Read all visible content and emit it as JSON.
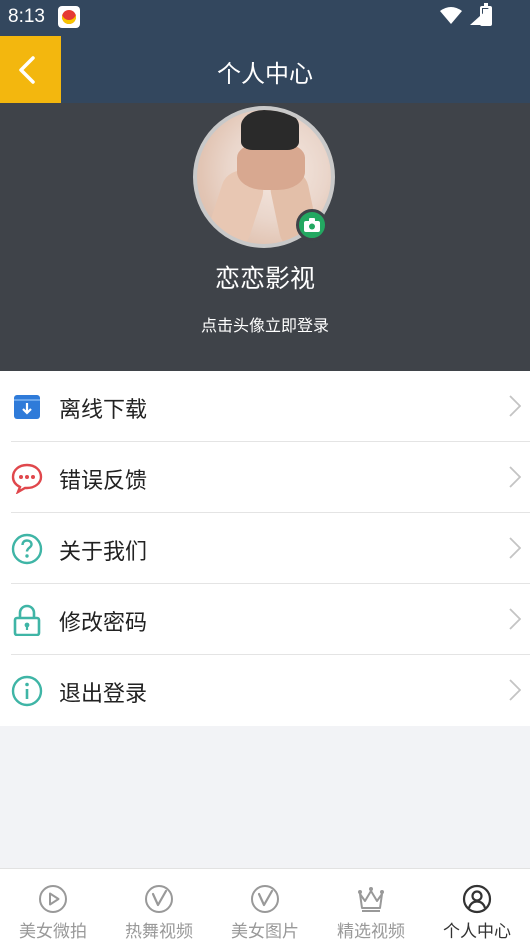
{
  "status_bar": {
    "time": "8:13"
  },
  "header": {
    "title": "个人中心",
    "back_icon": "chevron-left-icon"
  },
  "profile": {
    "name": "恋恋影视",
    "login_hint": "点击头像立即登录"
  },
  "menu": {
    "items": [
      {
        "label": "离线下载",
        "icon": "download-box-icon",
        "color": "#2f7bd9"
      },
      {
        "label": "错误反馈",
        "icon": "chat-bubble-icon",
        "color": "#e0474c"
      },
      {
        "label": "关于我们",
        "icon": "question-circle-icon",
        "color": "#3fb5a6"
      },
      {
        "label": "修改密码",
        "icon": "lock-icon",
        "color": "#3fb5a6"
      },
      {
        "label": "退出登录",
        "icon": "info-circle-icon",
        "color": "#3fb5a6"
      }
    ]
  },
  "tabbar": {
    "tabs": [
      {
        "label": "美女微拍",
        "icon": "play-circle-icon",
        "active": false
      },
      {
        "label": "热舞视频",
        "icon": "v-circle-icon",
        "active": false
      },
      {
        "label": "美女图片",
        "icon": "v-circle-icon",
        "active": false
      },
      {
        "label": "精选视频",
        "icon": "crown-icon",
        "active": false
      },
      {
        "label": "个人中心",
        "icon": "user-circle-icon",
        "active": true
      }
    ]
  },
  "colors": {
    "header_bg": "#33475e",
    "accent": "#f3b70e",
    "profile_bg": "#3f4349",
    "badge": "#23a861"
  }
}
